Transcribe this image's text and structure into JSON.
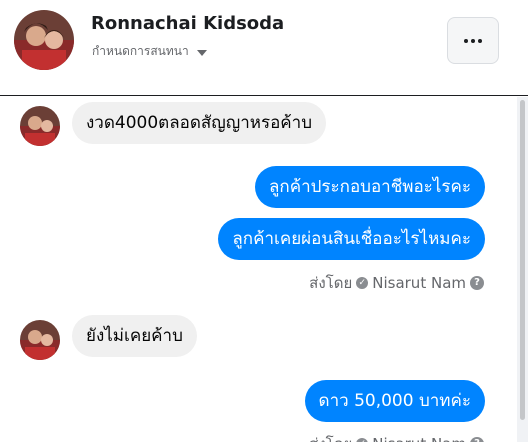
{
  "header": {
    "name": "Ronnachai Kidsoda",
    "status": "กำหนดการสนทนา",
    "more_icon": "more-dots-icon"
  },
  "messages": [
    {
      "direction": "in",
      "text": "งวด4000ตลอดสัญญาหรอค้าบ"
    },
    {
      "direction": "out",
      "text": "ลูกค้าประกอบอาชีพอะไรคะ"
    },
    {
      "direction": "out",
      "text": "ลูกค้าเคยผ่อนสินเชื่ออะไรไหมคะ"
    },
    {
      "direction": "in",
      "text": "ยังไม่เคยค้าบ"
    },
    {
      "direction": "out",
      "text": "ดาว 50,000 บาทค่ะ"
    }
  ],
  "sent_by": {
    "prefix": "ส่งโดย",
    "name": "Nisarut Nam",
    "help_glyph": "?"
  },
  "colors": {
    "outgoing_bubble": "#0084ff",
    "incoming_bubble": "#f0f0f0",
    "meta_text": "#65676b"
  }
}
